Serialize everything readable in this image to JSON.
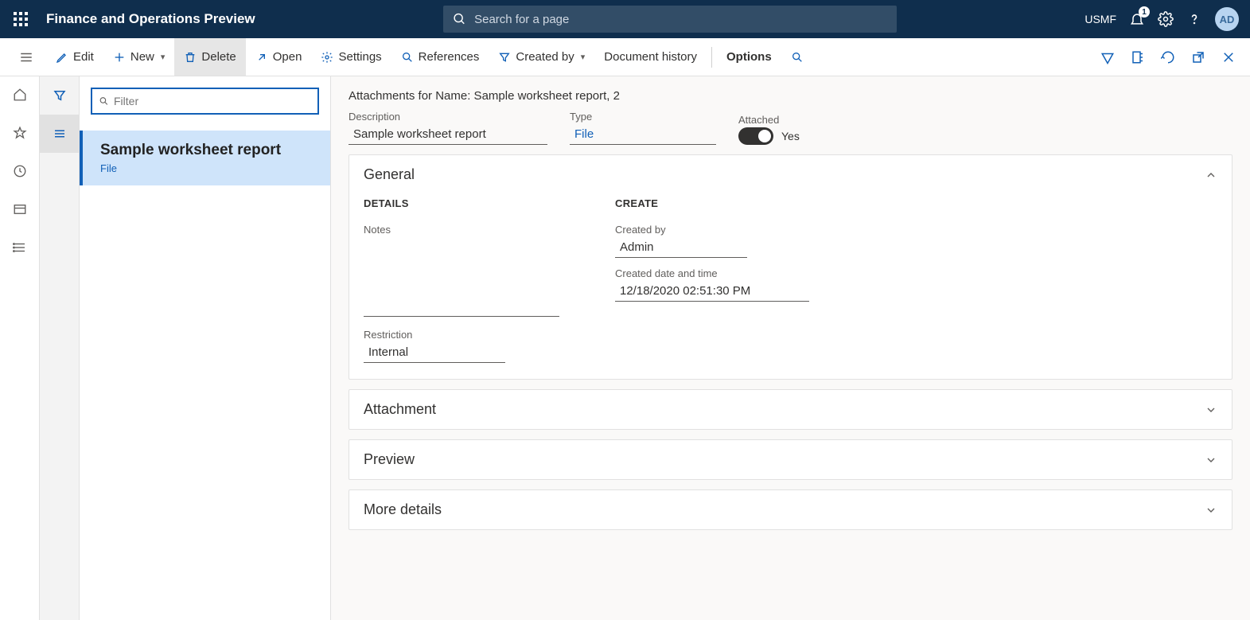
{
  "header": {
    "app_title": "Finance and Operations Preview",
    "search_placeholder": "Search for a page",
    "company": "USMF",
    "notification_count": "1",
    "avatar_initials": "AD"
  },
  "actionbar": {
    "edit": "Edit",
    "new": "New",
    "delete": "Delete",
    "open": "Open",
    "settings": "Settings",
    "references": "References",
    "created_by": "Created by",
    "doc_history": "Document history",
    "options": "Options"
  },
  "list": {
    "filter_placeholder": "Filter",
    "items": [
      {
        "title": "Sample worksheet report",
        "sub": "File"
      }
    ]
  },
  "detail": {
    "heading": "Attachments for Name: Sample worksheet report, 2",
    "description_label": "Description",
    "description_value": "Sample worksheet report",
    "type_label": "Type",
    "type_value": "File",
    "attached_label": "Attached",
    "attached_value": "Yes",
    "sections": {
      "general": {
        "title": "General",
        "details_heading": "DETAILS",
        "notes_label": "Notes",
        "notes_value": "",
        "restriction_label": "Restriction",
        "restriction_value": "Internal",
        "create_heading": "CREATE",
        "created_by_label": "Created by",
        "created_by_value": "Admin",
        "created_dt_label": "Created date and time",
        "created_dt_value": "12/18/2020 02:51:30 PM"
      },
      "attachment": {
        "title": "Attachment"
      },
      "preview": {
        "title": "Preview"
      },
      "more": {
        "title": "More details"
      }
    }
  }
}
